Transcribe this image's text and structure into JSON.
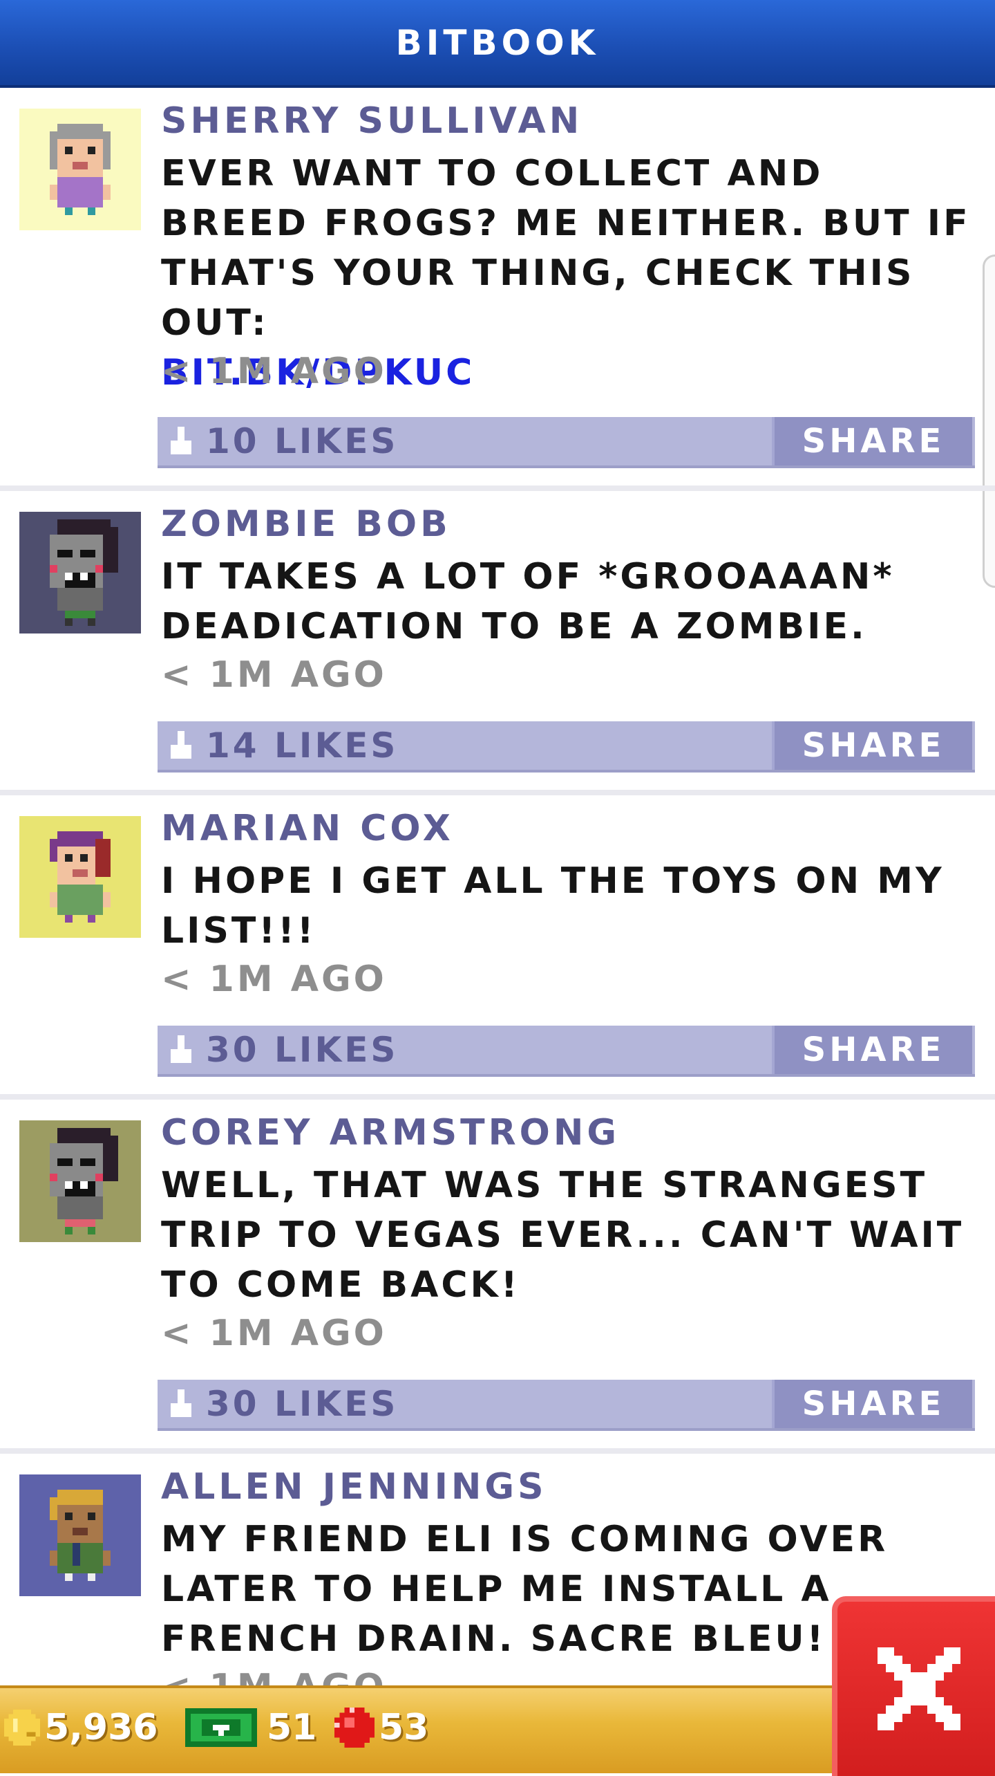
{
  "header": {
    "title": "BITBOOK"
  },
  "posts": [
    {
      "author": "SHERRY SULLIVAN",
      "message": "EVER WANT TO COLLECT AND BREED FROGS? ME NEITHER. BUT IF THAT'S YOUR THING, CHECK THIS OUT:",
      "link": "BIT.BK/DPKUC",
      "time": "< 1M AGO",
      "likes": "10 LIKES",
      "share_label": "SHARE",
      "avatar_bg": "#fafac0"
    },
    {
      "author": "ZOMBIE BOB",
      "message": "IT TAKES A LOT OF *GROOAAAN* DEADICATION TO BE A ZOMBIE.",
      "time": "< 1M AGO",
      "likes": "14 LIKES",
      "share_label": "SHARE",
      "avatar_bg": "#4e4e6e"
    },
    {
      "author": "MARIAN COX",
      "message": "I HOPE I GET ALL THE TOYS ON MY LIST!!!",
      "time": "< 1M AGO",
      "likes": "30 LIKES",
      "share_label": "SHARE",
      "avatar_bg": "#e8e472"
    },
    {
      "author": "COREY ARMSTRONG",
      "message": "WELL, THAT WAS THE STRANGEST TRIP TO VEGAS EVER... CAN'T WAIT TO COME BACK!",
      "time": "< 1M AGO",
      "likes": "30 LIKES",
      "share_label": "SHARE",
      "avatar_bg": "#9c9c62"
    },
    {
      "author": "ALLEN JENNINGS",
      "message": "MY FRIEND ELI IS COMING OVER LATER TO HELP ME INSTALL A FRENCH DRAIN. SACRE BLEU!",
      "time": "< 1M AGO",
      "avatar_bg": "#5e62aa"
    }
  ],
  "bottom_bar": {
    "coins": "5,936",
    "bux": "51",
    "tokens": "53"
  },
  "colors": {
    "header_blue": "#1c4fb5",
    "name_purple": "#5c5c94",
    "link_blue": "#1a22e0",
    "like_bar": "#b4b6da",
    "share_button": "#8f91c3",
    "bottom_gold": "#e9b83a",
    "close_red": "#d21e1e"
  },
  "icons": {
    "like": "thumbs-up-icon",
    "coin": "coin-icon",
    "bux": "bux-cash-icon",
    "token": "token-gem-icon",
    "close": "close-icon"
  }
}
